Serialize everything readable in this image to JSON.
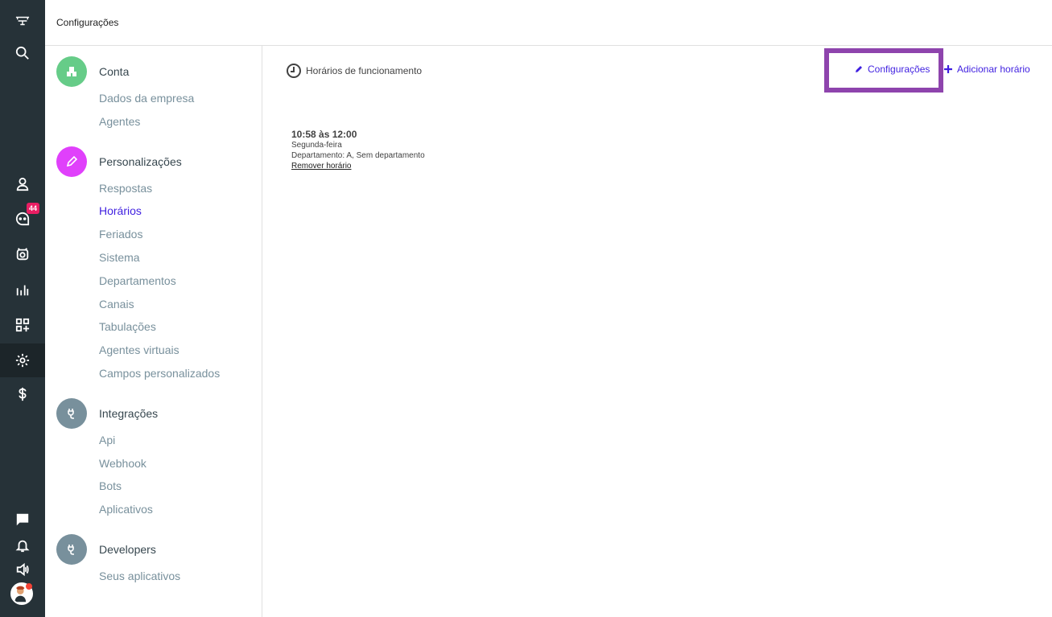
{
  "topbar": {
    "title": "Configurações"
  },
  "rail": {
    "badge_count": "44",
    "icons": [
      "logo-icon",
      "search-icon",
      "contacts-icon",
      "chat-icon",
      "bot-icon",
      "reports-icon",
      "apps-add-icon",
      "settings-icon",
      "billing-icon",
      "message-icon",
      "bell-icon",
      "sound-icon"
    ]
  },
  "menu": {
    "groups": [
      {
        "label": "Conta",
        "color": "#66cc88",
        "items": [
          "Dados da empresa",
          "Agentes"
        ]
      },
      {
        "label": "Personalizações",
        "color": "#e040fb",
        "items": [
          "Respostas",
          "Horários",
          "Feriados",
          "Sistema",
          "Departamentos",
          "Canais",
          "Tabulações",
          "Agentes virtuais",
          "Campos personalizados"
        ]
      },
      {
        "label": "Integrações",
        "color": "#78909c",
        "items": [
          "Api",
          "Webhook",
          "Bots",
          "Aplicativos"
        ]
      },
      {
        "label": "Developers",
        "color": "#78909c",
        "items": [
          "Seus aplicativos"
        ]
      }
    ],
    "active_item": "Horários"
  },
  "main": {
    "title": "Horários de funcionamento",
    "settings_label": "Configurações",
    "add_label": "Adicionar horário",
    "entries": [
      {
        "time": "10:58 às 12:00",
        "day": "Segunda-feira",
        "department": "Departamento: A, Sem departamento",
        "remove_label": "Remover horário"
      }
    ]
  },
  "colors": {
    "accent": "#3f1fe0",
    "rail": "#263238",
    "highlight": "#8e44ad",
    "badge": "#e91e63"
  }
}
